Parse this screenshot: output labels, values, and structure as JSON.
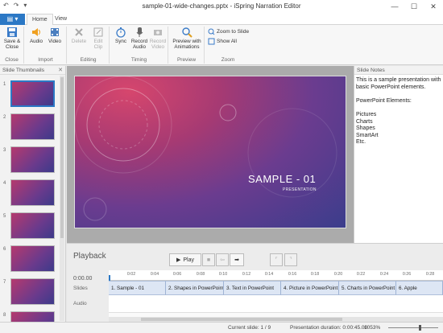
{
  "window": {
    "title": "sample-01-wide-changes.pptx - iSpring Narration Editor",
    "controls": [
      "minimize",
      "maximize",
      "close"
    ]
  },
  "quick_access": [
    "undo-icon",
    "redo-icon"
  ],
  "ribbon": {
    "tabs": [
      {
        "label": "Home",
        "active": true
      },
      {
        "label": "View",
        "active": false
      }
    ],
    "groups": [
      {
        "label": "Close",
        "buttons": [
          {
            "label": "Save &\nClose",
            "icon": "save-icon"
          }
        ]
      },
      {
        "label": "Import",
        "buttons": [
          {
            "label": "Audio",
            "icon": "speaker-icon"
          },
          {
            "label": "Video",
            "icon": "film-icon"
          }
        ]
      },
      {
        "label": "Editing",
        "buttons": [
          {
            "label": "Delete",
            "icon": "delete-icon",
            "disabled": true
          },
          {
            "label": "Edit\nClip",
            "icon": "edit-clip-icon",
            "disabled": true
          }
        ]
      },
      {
        "label": "Timing",
        "buttons": [
          {
            "label": "Sync",
            "icon": "stopwatch-icon"
          },
          {
            "label": "Record\nAudio",
            "icon": "microphone-icon"
          },
          {
            "label": "Record\nVideo",
            "icon": "camera-icon",
            "disabled": true
          }
        ]
      },
      {
        "label": "Preview",
        "buttons": [
          {
            "label": "Preview with\nAnimations",
            "icon": "preview-icon"
          }
        ]
      },
      {
        "label": "Zoom",
        "buttons": [
          {
            "label": "Zoom to Slide",
            "icon": "zoom-slide-icon"
          },
          {
            "label": "Show All",
            "icon": "show-all-icon"
          }
        ]
      }
    ]
  },
  "thumbnails": {
    "header": "Slide Thumbnails",
    "items": [
      {
        "num": "1",
        "selected": true
      },
      {
        "num": "2"
      },
      {
        "num": "3"
      },
      {
        "num": "4"
      },
      {
        "num": "5"
      },
      {
        "num": "6"
      },
      {
        "num": "7"
      },
      {
        "num": "8"
      }
    ]
  },
  "slide": {
    "title": "SAMPLE - 01",
    "subtitle": "PRESENTATION"
  },
  "notes": {
    "header": "Slide Notes",
    "text": "This is a sample presentation with basic PowerPoint elements.\n\nPowerPoint Elements:\n\nPictures\nCharts\nShapes\nSmartArt\nEtc."
  },
  "playback": {
    "label": "Playback",
    "play_label": "Play",
    "time": "0:00.00",
    "rows": [
      "Slides",
      "Audio"
    ],
    "ticks": [
      "0:02",
      "0:04",
      "0:06",
      "0:08",
      "0:10",
      "0:12",
      "0:14",
      "0:16",
      "0:18",
      "0:20",
      "0:22",
      "0:24",
      "0:26",
      "0:28"
    ],
    "segments": [
      "1. Sample - 01",
      "2. Shapes in PowerPoint",
      "3. Text in PowerPoint",
      "4. Picture in PowerPoint",
      "5. Charts in PowerPoint",
      "6. Apple"
    ]
  },
  "status": {
    "current_slide": "Current slide: 1 / 9",
    "duration": "Presentation duration: 0:00:45.00",
    "zoom": "1053%"
  }
}
